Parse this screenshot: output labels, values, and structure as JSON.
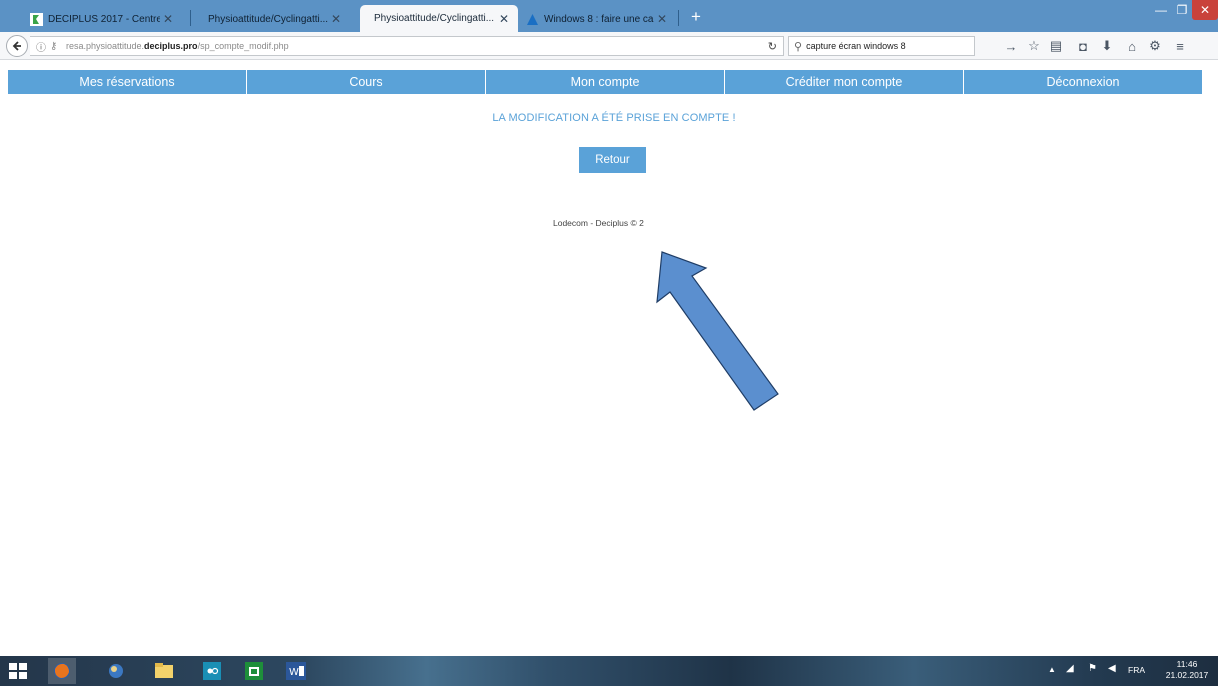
{
  "browser": {
    "tabs": [
      {
        "title": "DECIPLUS 2017 - Centre P...",
        "active": false
      },
      {
        "title": "Physioattitude/Cyclingatti...",
        "active": false
      },
      {
        "title": "Physioattitude/Cyclingatti...",
        "active": true
      },
      {
        "title": "Windows 8 : faire une cap...",
        "active": false
      }
    ],
    "new_tab_label": "+",
    "url": {
      "prefix": "resa.physioattitude.",
      "domain": "deciplus.pro",
      "path": "/sp_compte_modif.php"
    },
    "search_value": "capture écran windows 8"
  },
  "site": {
    "menu": [
      "Mes réservations",
      "Cours",
      "Mon compte",
      "Créditer mon compte",
      "Déconnexion"
    ],
    "confirmation": "LA MODIFICATION A ÉTÉ PRISE EN COMPTE !",
    "back_button": "Retour",
    "footer": "Lodecom - Deciplus © 2"
  },
  "taskbar": {
    "language": "FRA",
    "time": "11:46",
    "date": "21.02.2017"
  },
  "colors": {
    "accent": "#5aa2d8",
    "tabstrip": "#5b92c5",
    "annotation_arrow": "#5b8fcf"
  }
}
